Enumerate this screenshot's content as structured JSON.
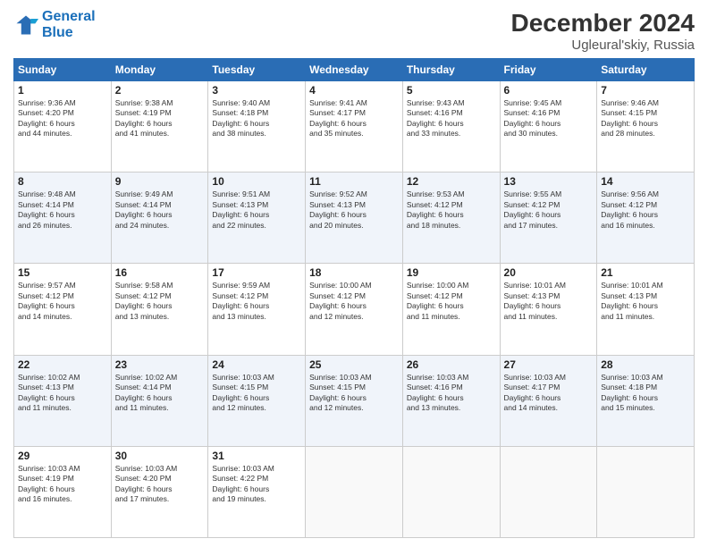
{
  "logo": {
    "line1": "General",
    "line2": "Blue"
  },
  "title": "December 2024",
  "subtitle": "Ugleural'skiy, Russia",
  "header_days": [
    "Sunday",
    "Monday",
    "Tuesday",
    "Wednesday",
    "Thursday",
    "Friday",
    "Saturday"
  ],
  "weeks": [
    [
      {
        "day": "1",
        "lines": [
          "Sunrise: 9:36 AM",
          "Sunset: 4:20 PM",
          "Daylight: 6 hours",
          "and 44 minutes."
        ]
      },
      {
        "day": "2",
        "lines": [
          "Sunrise: 9:38 AM",
          "Sunset: 4:19 PM",
          "Daylight: 6 hours",
          "and 41 minutes."
        ]
      },
      {
        "day": "3",
        "lines": [
          "Sunrise: 9:40 AM",
          "Sunset: 4:18 PM",
          "Daylight: 6 hours",
          "and 38 minutes."
        ]
      },
      {
        "day": "4",
        "lines": [
          "Sunrise: 9:41 AM",
          "Sunset: 4:17 PM",
          "Daylight: 6 hours",
          "and 35 minutes."
        ]
      },
      {
        "day": "5",
        "lines": [
          "Sunrise: 9:43 AM",
          "Sunset: 4:16 PM",
          "Daylight: 6 hours",
          "and 33 minutes."
        ]
      },
      {
        "day": "6",
        "lines": [
          "Sunrise: 9:45 AM",
          "Sunset: 4:16 PM",
          "Daylight: 6 hours",
          "and 30 minutes."
        ]
      },
      {
        "day": "7",
        "lines": [
          "Sunrise: 9:46 AM",
          "Sunset: 4:15 PM",
          "Daylight: 6 hours",
          "and 28 minutes."
        ]
      }
    ],
    [
      {
        "day": "8",
        "lines": [
          "Sunrise: 9:48 AM",
          "Sunset: 4:14 PM",
          "Daylight: 6 hours",
          "and 26 minutes."
        ]
      },
      {
        "day": "9",
        "lines": [
          "Sunrise: 9:49 AM",
          "Sunset: 4:14 PM",
          "Daylight: 6 hours",
          "and 24 minutes."
        ]
      },
      {
        "day": "10",
        "lines": [
          "Sunrise: 9:51 AM",
          "Sunset: 4:13 PM",
          "Daylight: 6 hours",
          "and 22 minutes."
        ]
      },
      {
        "day": "11",
        "lines": [
          "Sunrise: 9:52 AM",
          "Sunset: 4:13 PM",
          "Daylight: 6 hours",
          "and 20 minutes."
        ]
      },
      {
        "day": "12",
        "lines": [
          "Sunrise: 9:53 AM",
          "Sunset: 4:12 PM",
          "Daylight: 6 hours",
          "and 18 minutes."
        ]
      },
      {
        "day": "13",
        "lines": [
          "Sunrise: 9:55 AM",
          "Sunset: 4:12 PM",
          "Daylight: 6 hours",
          "and 17 minutes."
        ]
      },
      {
        "day": "14",
        "lines": [
          "Sunrise: 9:56 AM",
          "Sunset: 4:12 PM",
          "Daylight: 6 hours",
          "and 16 minutes."
        ]
      }
    ],
    [
      {
        "day": "15",
        "lines": [
          "Sunrise: 9:57 AM",
          "Sunset: 4:12 PM",
          "Daylight: 6 hours",
          "and 14 minutes."
        ]
      },
      {
        "day": "16",
        "lines": [
          "Sunrise: 9:58 AM",
          "Sunset: 4:12 PM",
          "Daylight: 6 hours",
          "and 13 minutes."
        ]
      },
      {
        "day": "17",
        "lines": [
          "Sunrise: 9:59 AM",
          "Sunset: 4:12 PM",
          "Daylight: 6 hours",
          "and 13 minutes."
        ]
      },
      {
        "day": "18",
        "lines": [
          "Sunrise: 10:00 AM",
          "Sunset: 4:12 PM",
          "Daylight: 6 hours",
          "and 12 minutes."
        ]
      },
      {
        "day": "19",
        "lines": [
          "Sunrise: 10:00 AM",
          "Sunset: 4:12 PM",
          "Daylight: 6 hours",
          "and 11 minutes."
        ]
      },
      {
        "day": "20",
        "lines": [
          "Sunrise: 10:01 AM",
          "Sunset: 4:13 PM",
          "Daylight: 6 hours",
          "and 11 minutes."
        ]
      },
      {
        "day": "21",
        "lines": [
          "Sunrise: 10:01 AM",
          "Sunset: 4:13 PM",
          "Daylight: 6 hours",
          "and 11 minutes."
        ]
      }
    ],
    [
      {
        "day": "22",
        "lines": [
          "Sunrise: 10:02 AM",
          "Sunset: 4:13 PM",
          "Daylight: 6 hours",
          "and 11 minutes."
        ]
      },
      {
        "day": "23",
        "lines": [
          "Sunrise: 10:02 AM",
          "Sunset: 4:14 PM",
          "Daylight: 6 hours",
          "and 11 minutes."
        ]
      },
      {
        "day": "24",
        "lines": [
          "Sunrise: 10:03 AM",
          "Sunset: 4:15 PM",
          "Daylight: 6 hours",
          "and 12 minutes."
        ]
      },
      {
        "day": "25",
        "lines": [
          "Sunrise: 10:03 AM",
          "Sunset: 4:15 PM",
          "Daylight: 6 hours",
          "and 12 minutes."
        ]
      },
      {
        "day": "26",
        "lines": [
          "Sunrise: 10:03 AM",
          "Sunset: 4:16 PM",
          "Daylight: 6 hours",
          "and 13 minutes."
        ]
      },
      {
        "day": "27",
        "lines": [
          "Sunrise: 10:03 AM",
          "Sunset: 4:17 PM",
          "Daylight: 6 hours",
          "and 14 minutes."
        ]
      },
      {
        "day": "28",
        "lines": [
          "Sunrise: 10:03 AM",
          "Sunset: 4:18 PM",
          "Daylight: 6 hours",
          "and 15 minutes."
        ]
      }
    ],
    [
      {
        "day": "29",
        "lines": [
          "Sunrise: 10:03 AM",
          "Sunset: 4:19 PM",
          "Daylight: 6 hours",
          "and 16 minutes."
        ]
      },
      {
        "day": "30",
        "lines": [
          "Sunrise: 10:03 AM",
          "Sunset: 4:20 PM",
          "Daylight: 6 hours",
          "and 17 minutes."
        ]
      },
      {
        "day": "31",
        "lines": [
          "Sunrise: 10:03 AM",
          "Sunset: 4:22 PM",
          "Daylight: 6 hours",
          "and 19 minutes."
        ]
      },
      null,
      null,
      null,
      null
    ]
  ]
}
